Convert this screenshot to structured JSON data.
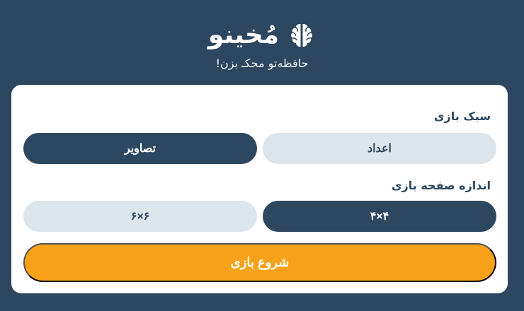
{
  "header": {
    "title": "مُخینو",
    "tagline": "حافظه‌تو محکـ بزن!",
    "icon": "brain-icon"
  },
  "settings": {
    "style_label": "سبک بازی",
    "style_options": [
      {
        "label": "اعداد",
        "selected": false
      },
      {
        "label": "تصاویر",
        "selected": true
      }
    ],
    "size_label": "اندازه صفحه بازی",
    "size_options": [
      {
        "label": "۴×۴",
        "selected": true
      },
      {
        "label": "۶×۶",
        "selected": false
      }
    ]
  },
  "start_button": {
    "label": "شروع بازی"
  },
  "colors": {
    "background": "#2e4760",
    "card": "#ffffff",
    "selected": "#2e4760",
    "unselected": "#dde5ec",
    "accent": "#f8a21a"
  }
}
